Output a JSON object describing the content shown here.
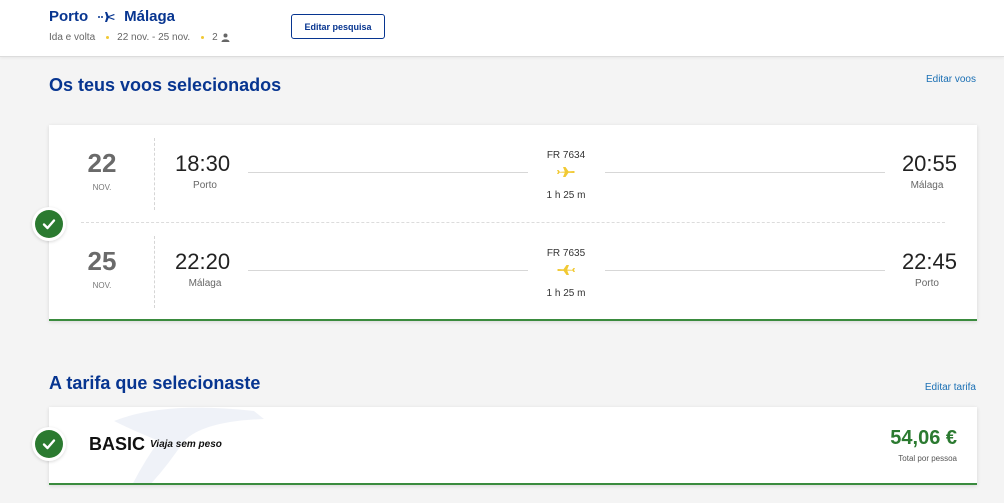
{
  "header": {
    "origin": "Porto",
    "destination": "Málaga",
    "trip_type": "Ida e volta",
    "dates": "22 nov. - 25 nov.",
    "passengers": "2",
    "edit_search_label": "Editar pesquisa",
    "dot_color": "#f1c933"
  },
  "flights_section": {
    "title": "Os teus voos selecionados",
    "edit_label": "Editar voos",
    "flights": [
      {
        "day": "22",
        "month": "NOV.",
        "departure_time": "18:30",
        "departure_city": "Porto",
        "flight_number": "FR 7634",
        "duration": "1 h 25 m",
        "arrival_time": "20:55",
        "arrival_city": "Málaga"
      },
      {
        "day": "25",
        "month": "NOV.",
        "departure_time": "22:20",
        "departure_city": "Málaga",
        "flight_number": "FR 7635",
        "duration": "1 h 25 m",
        "arrival_time": "22:45",
        "arrival_city": "Porto"
      }
    ]
  },
  "fare_section": {
    "title": "A tarifa que selecionaste",
    "edit_label": "Editar tarifa",
    "fare_name": "BASIC",
    "fare_description": "Viaja sem peso",
    "price": "54,06 €",
    "price_label": "Total por pessoa"
  },
  "colors": {
    "brand_blue": "#073590",
    "accent_yellow": "#f1c933",
    "success_green": "#2b7a30",
    "link_blue": "#1a6fb4"
  },
  "icons": {
    "route": "plane-icon",
    "passengers": "person-icon",
    "selected": "check-icon",
    "flight": "plane-icon"
  }
}
